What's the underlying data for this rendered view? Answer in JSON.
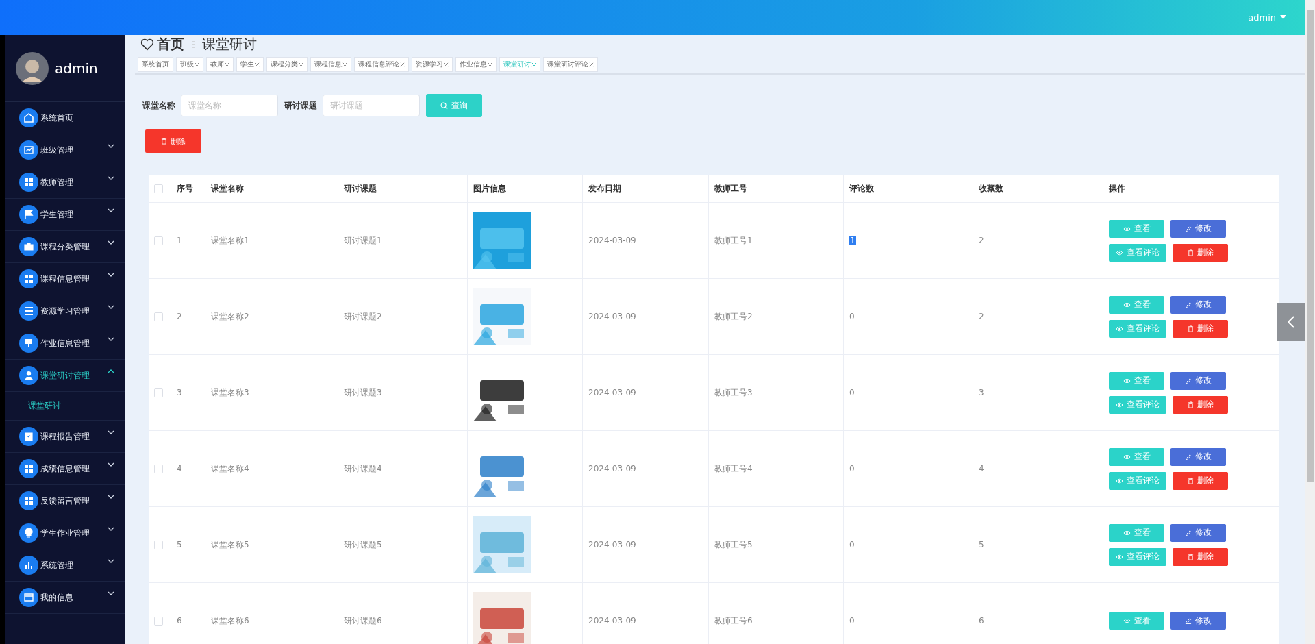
{
  "header": {
    "user": "admin"
  },
  "sidebar": {
    "user": "admin",
    "items": [
      {
        "label": "系统首页",
        "selected": false
      },
      {
        "label": "班级管理",
        "selected": false,
        "expanded": false,
        "expandable": true
      },
      {
        "label": "教师管理",
        "selected": false,
        "expanded": false,
        "expandable": true
      },
      {
        "label": "学生管理",
        "selected": false,
        "expanded": false,
        "expandable": true
      },
      {
        "label": "课程分类管理",
        "selected": false,
        "expanded": false,
        "expandable": true
      },
      {
        "label": "课程信息管理",
        "selected": false,
        "expanded": false,
        "expandable": true
      },
      {
        "label": "资源学习管理",
        "selected": false,
        "expanded": false,
        "expandable": true
      },
      {
        "label": "作业信息管理",
        "selected": false,
        "expanded": false,
        "expandable": true
      },
      {
        "label": "课堂研讨管理",
        "selected": true,
        "expanded": true,
        "expandable": true,
        "children": [
          {
            "label": "课堂研讨",
            "selected": true
          }
        ]
      },
      {
        "label": "课程报告管理",
        "selected": false,
        "expanded": false,
        "expandable": true
      },
      {
        "label": "成绩信息管理",
        "selected": false,
        "expanded": false,
        "expandable": true
      },
      {
        "label": "反馈留言管理",
        "selected": false,
        "expanded": false,
        "expandable": true
      },
      {
        "label": "学生作业管理",
        "selected": false,
        "expanded": false,
        "expandable": true
      },
      {
        "label": "系统管理",
        "selected": false,
        "expanded": false,
        "expandable": true
      },
      {
        "label": "我的信息",
        "selected": false,
        "expanded": false,
        "expandable": true
      }
    ]
  },
  "breadcrumb": [
    "首页",
    "课堂研讨"
  ],
  "tabs": [
    {
      "label": "系统首页",
      "selected": false,
      "closable": false
    },
    {
      "label": "班级",
      "selected": false,
      "closable": true
    },
    {
      "label": "教师",
      "selected": false,
      "closable": true
    },
    {
      "label": "学生",
      "selected": false,
      "closable": true
    },
    {
      "label": "课程分类",
      "selected": false,
      "closable": true
    },
    {
      "label": "课程信息",
      "selected": false,
      "closable": true
    },
    {
      "label": "课程信息评论",
      "selected": false,
      "closable": true
    },
    {
      "label": "资源学习",
      "selected": false,
      "closable": true
    },
    {
      "label": "作业信息",
      "selected": false,
      "closable": true
    },
    {
      "label": "课堂研讨",
      "selected": true,
      "closable": true
    },
    {
      "label": "课堂研讨评论",
      "selected": false,
      "closable": true
    }
  ],
  "search": {
    "fields": [
      {
        "label": "课堂名称",
        "placeholder": "课堂名称"
      },
      {
        "label": "研讨课题",
        "placeholder": "研讨课题"
      }
    ],
    "button": "查询"
  },
  "toolbar": {
    "delete_button": "删除"
  },
  "table": {
    "all_checked": false,
    "columns": [
      "序号",
      "课堂名称",
      "研讨课题",
      "图片信息",
      "发布日期",
      "教师工号",
      "评论数",
      "收藏数",
      "操作"
    ],
    "rows": [
      {
        "checked": false,
        "index": "1",
        "name": "课堂名称1",
        "topic": "研讨课题1",
        "date": "2024-03-09",
        "teacher": "教师工号1",
        "comments": "1",
        "comments_highlighted": true,
        "favorites": "2",
        "actions": [
          {
            "label": "查看",
            "kind": "view"
          },
          {
            "label": "修改",
            "kind": "edit"
          },
          {
            "label": "查看评论",
            "kind": "view"
          },
          {
            "label": "删除",
            "kind": "delete"
          }
        ]
      },
      {
        "checked": false,
        "index": "2",
        "name": "课堂名称2",
        "topic": "研讨课题2",
        "date": "2024-03-09",
        "teacher": "教师工号2",
        "comments": "0",
        "comments_highlighted": false,
        "favorites": "2",
        "actions": [
          {
            "label": "查看",
            "kind": "view"
          },
          {
            "label": "修改",
            "kind": "edit"
          },
          {
            "label": "查看评论",
            "kind": "view"
          },
          {
            "label": "删除",
            "kind": "delete"
          }
        ]
      },
      {
        "checked": false,
        "index": "3",
        "name": "课堂名称3",
        "topic": "研讨课题3",
        "date": "2024-03-09",
        "teacher": "教师工号3",
        "comments": "0",
        "comments_highlighted": false,
        "favorites": "3",
        "actions": [
          {
            "label": "查看",
            "kind": "view"
          },
          {
            "label": "修改",
            "kind": "edit"
          },
          {
            "label": "查看评论",
            "kind": "view"
          },
          {
            "label": "删除",
            "kind": "delete"
          }
        ]
      },
      {
        "checked": false,
        "index": "4",
        "name": "课堂名称4",
        "topic": "研讨课题4",
        "date": "2024-03-09",
        "teacher": "教师工号4",
        "comments": "0",
        "comments_highlighted": false,
        "favorites": "4",
        "actions": [
          {
            "label": "查看",
            "kind": "view"
          },
          {
            "label": "修改",
            "kind": "edit"
          },
          {
            "label": "查看评论",
            "kind": "view"
          },
          {
            "label": "删除",
            "kind": "delete"
          }
        ]
      },
      {
        "checked": false,
        "index": "5",
        "name": "课堂名称5",
        "topic": "研讨课题5",
        "date": "2024-03-09",
        "teacher": "教师工号5",
        "comments": "0",
        "comments_highlighted": false,
        "favorites": "5",
        "actions": [
          {
            "label": "查看",
            "kind": "view"
          },
          {
            "label": "修改",
            "kind": "edit"
          },
          {
            "label": "查看评论",
            "kind": "view"
          },
          {
            "label": "删除",
            "kind": "delete"
          }
        ]
      },
      {
        "checked": false,
        "index": "6",
        "name": "课堂名称6",
        "topic": "研讨课题6",
        "date": "2024-03-09",
        "teacher": "教师工号6",
        "comments": "0",
        "comments_highlighted": false,
        "favorites": "6",
        "actions": [
          {
            "label": "查看",
            "kind": "view"
          },
          {
            "label": "修改",
            "kind": "edit"
          }
        ]
      }
    ]
  }
}
